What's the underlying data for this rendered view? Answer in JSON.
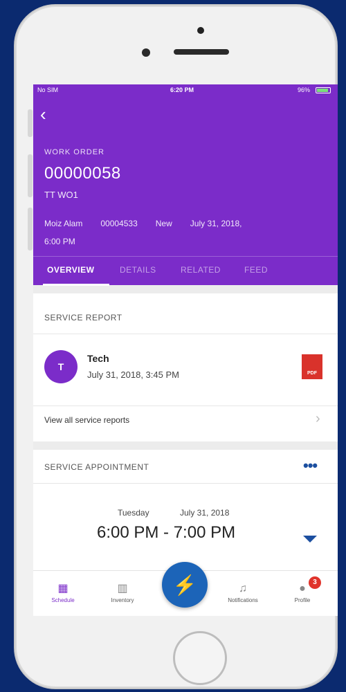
{
  "status_bar": {
    "carrier": "No SIM",
    "time": "6:20 PM",
    "battery": "96%"
  },
  "header": {
    "back_icon": "chevron-left-icon",
    "label": "WORK ORDER",
    "number": "00000058",
    "subtitle": "TT WO1",
    "meta": [
      "Moiz Alam",
      "00004533",
      "New",
      "July 31, 2018,",
      "6:00 PM"
    ]
  },
  "tabs": [
    {
      "label": "OVERVIEW",
      "active": true
    },
    {
      "label": "DETAILS"
    },
    {
      "label": "RELATED"
    },
    {
      "label": "FEED"
    }
  ],
  "service_report": {
    "title": "SERVICE REPORT",
    "avatar_initial": "T",
    "name": "Tech",
    "date": "July 31, 2018, 3:45 PM",
    "file_icon": "pdf-icon",
    "file_label": "PDF",
    "view_all": "View all service reports"
  },
  "service_appointment": {
    "title": "SERVICE APPOINTMENT",
    "day": "Tuesday",
    "date": "July 31, 2018",
    "time": "6:00 PM - 7:00 PM"
  },
  "tabbar": {
    "items": [
      {
        "label": "Schedule",
        "icon": "calendar-icon",
        "active": true
      },
      {
        "label": "Inventory",
        "icon": "inventory-icon"
      },
      {
        "label": "Notifications",
        "icon": "bell-icon"
      },
      {
        "label": "Profile",
        "icon": "profile-icon",
        "badge": "3"
      }
    ],
    "fab_icon": "lightning-icon"
  },
  "colors": {
    "primary": "#7b2cc9",
    "accent": "#1c64b8",
    "background": "#0b2a6f"
  }
}
